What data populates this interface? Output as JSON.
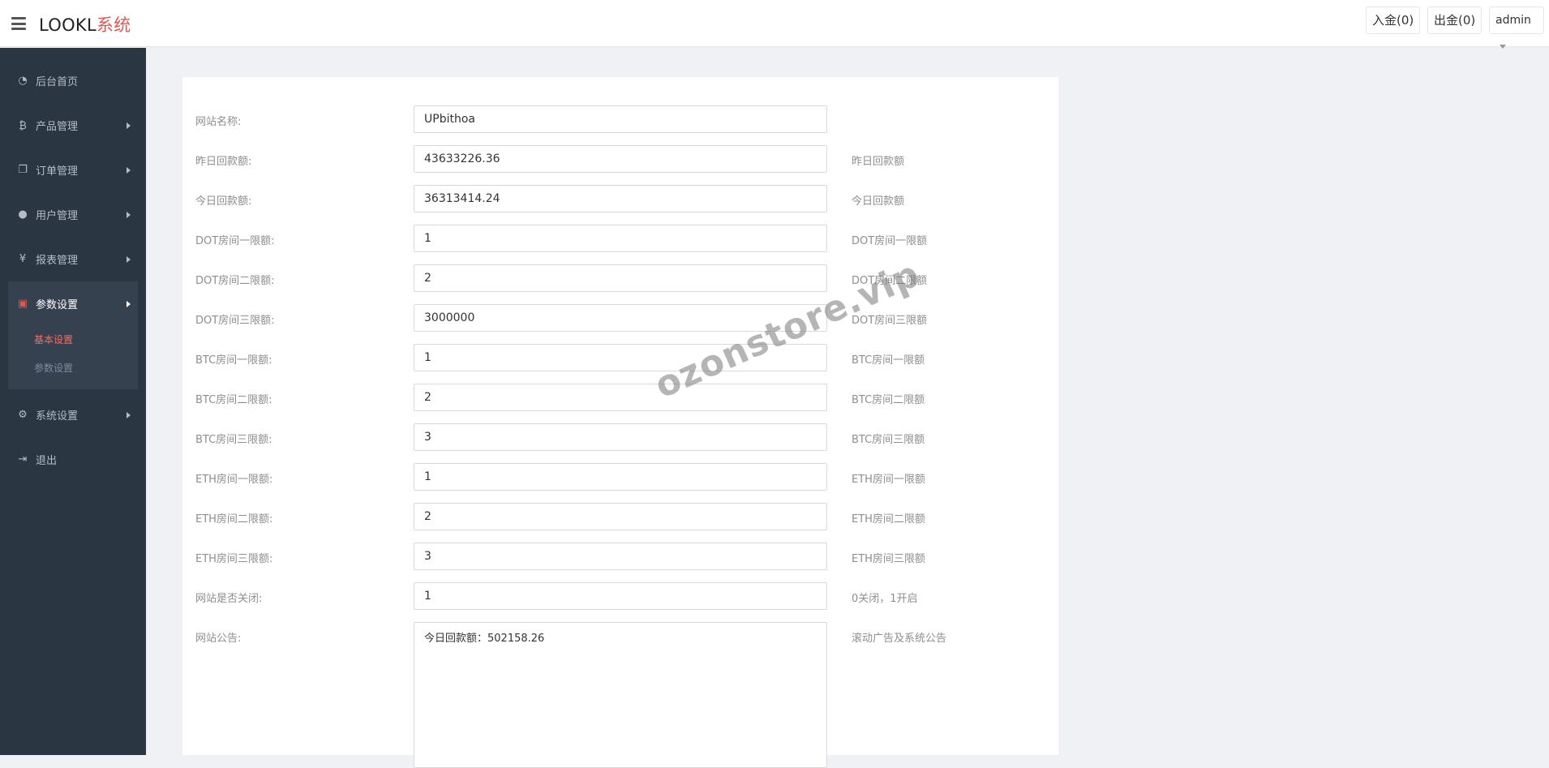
{
  "header": {
    "brand_main": "LOOKL",
    "brand_accent": "系统",
    "deposit_label": "入金(0)",
    "withdraw_label": "出金(0)",
    "user_label": "admin"
  },
  "sidebar": {
    "items": [
      {
        "label": "后台首页",
        "icon": "dashboard-icon"
      },
      {
        "label": "产品管理",
        "icon": "bitcoin-icon"
      },
      {
        "label": "订单管理",
        "icon": "copy-icon"
      },
      {
        "label": "用户管理",
        "icon": "user-icon"
      },
      {
        "label": "报表管理",
        "icon": "yen-icon"
      },
      {
        "label": "参数设置",
        "icon": "files-icon"
      },
      {
        "label": "系统设置",
        "icon": "cogs-icon"
      },
      {
        "label": "退出",
        "icon": "sign-out-icon"
      }
    ],
    "submenu": [
      "基本设置",
      "参数设置"
    ]
  },
  "form": {
    "rows": [
      {
        "label": "网站名称:",
        "value": "UPbithoa",
        "hint": ""
      },
      {
        "label": "昨日回款额:",
        "value": "43633226.36",
        "hint": "昨日回款额"
      },
      {
        "label": "今日回款额:",
        "value": "36313414.24",
        "hint": "今日回款额"
      },
      {
        "label": "DOT房间一限额:",
        "value": "1",
        "hint": "DOT房间一限额"
      },
      {
        "label": "DOT房间二限额:",
        "value": "2",
        "hint": "DOT房间二限额"
      },
      {
        "label": "DOT房间三限额:",
        "value": "3000000",
        "hint": "DOT房间三限额"
      },
      {
        "label": "BTC房间一限额:",
        "value": "1",
        "hint": "BTC房间一限额"
      },
      {
        "label": "BTC房间二限额:",
        "value": "2",
        "hint": "BTC房间二限额"
      },
      {
        "label": "BTC房间三限额:",
        "value": "3",
        "hint": "BTC房间三限额"
      },
      {
        "label": "ETH房间一限额:",
        "value": "1",
        "hint": "ETH房间一限额"
      },
      {
        "label": "ETH房间二限额:",
        "value": "2",
        "hint": "ETH房间二限额"
      },
      {
        "label": "ETH房间三限额:",
        "value": "3",
        "hint": "ETH房间三限额"
      },
      {
        "label": "网站是否关闭:",
        "value": "1",
        "hint": "0关闭，1开启"
      }
    ],
    "notice": {
      "label": "网站公告:",
      "value": "今日回款额：502158.26",
      "hint": "滚动广告及系统公告"
    }
  },
  "watermark": "ozonstore.vip",
  "colors": {
    "sidebar_bg": "#2b3643",
    "accent": "#e2574c",
    "page_bg": "#f0f1f4"
  }
}
